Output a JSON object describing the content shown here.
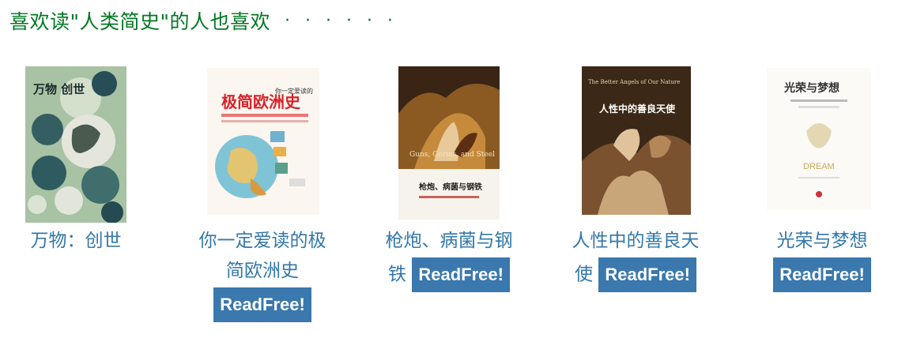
{
  "section": {
    "title": "喜欢读\"人类简史\"的人也喜欢",
    "more": "· · · · · ·"
  },
  "books": [
    {
      "title_line1": "万物：创世",
      "title_line2": "",
      "cover_text": "万物 创世",
      "readfree": ""
    },
    {
      "title_line1": "你一定爱读的极",
      "title_line2": "简欧洲史",
      "cover_text": "极简欧洲史",
      "cover_subtitle": "你一定爱读的",
      "readfree": "ReadFree!"
    },
    {
      "title_line1": "枪炮、病菌与钢",
      "title_line2": "铁",
      "cover_text": "Guns, Germs, and Steel",
      "cover_subtitle": "枪炮、病菌与钢铁",
      "readfree": "ReadFree!"
    },
    {
      "title_line1": "人性中的善良天",
      "title_line2": "使",
      "cover_text": "人性中的善良天使",
      "cover_subtitle": "The Better Angels of Our Nature",
      "readfree": "ReadFree!"
    },
    {
      "title_line1": "光荣与梦想",
      "title_line2": "",
      "cover_text": "光荣与梦想",
      "cover_subtitle": "DREAM",
      "readfree": "ReadFree!"
    }
  ],
  "colors": {
    "heading": "#007722",
    "link": "#3377aa",
    "button": "#3a78ad"
  }
}
